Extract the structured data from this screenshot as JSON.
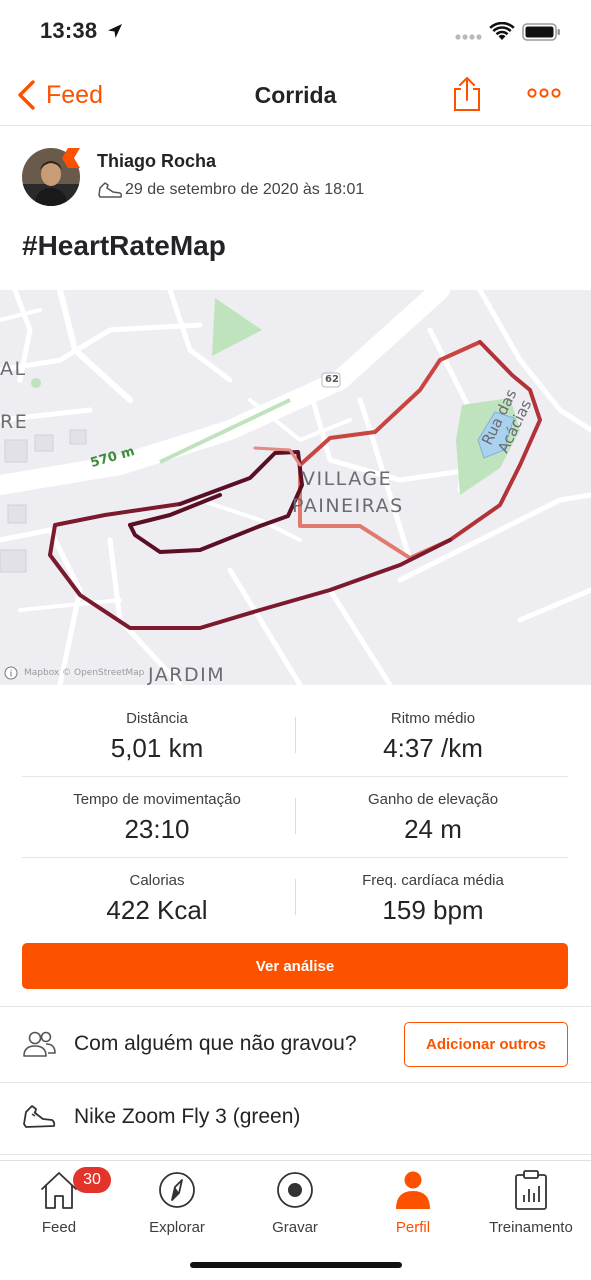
{
  "status_bar": {
    "time": "13:38"
  },
  "nav": {
    "back_label": "Feed",
    "title": "Corrida"
  },
  "athlete": {
    "name": "Thiago Rocha",
    "date": "29 de setembro de 2020 às 18:01"
  },
  "activity": {
    "title": "#HeartRateMap"
  },
  "map": {
    "labels": {
      "elev_marker": "570 m",
      "highway": "62",
      "district_1": "VILLAGE",
      "district_2": "PAINEIRAS",
      "street": "Rua das Acácias",
      "jardim": "JARDIM",
      "left_1": "AL",
      "left_2": "RE",
      "attribution": "Mapbox © OpenStreetMap"
    },
    "colors": {
      "route_high": "#5a0f24",
      "route_mid": "#b2323a",
      "route_low": "#e07a6e",
      "park": "#bfe3bc",
      "water": "#a9d2ee"
    }
  },
  "stats": [
    {
      "left": {
        "label": "Distância",
        "value": "5,01 km"
      },
      "right": {
        "label": "Ritmo médio",
        "value": "4:37 /km"
      }
    },
    {
      "left": {
        "label": "Tempo de movimentação",
        "value": "23:10"
      },
      "right": {
        "label": "Ganho de elevação",
        "value": "24 m"
      }
    },
    {
      "left": {
        "label": "Calorias",
        "value": "422 Kcal"
      },
      "right": {
        "label": "Freq. cardíaca média",
        "value": "159 bpm"
      }
    }
  ],
  "cta": {
    "label": "Ver análise"
  },
  "with_others": {
    "text": "Com alguém que não gravou?",
    "button": "Adicionar outros"
  },
  "gear": {
    "text": "Nike Zoom Fly 3 (green)"
  },
  "tabs": [
    {
      "label": "Feed",
      "icon": "home-icon",
      "badge": "30"
    },
    {
      "label": "Explorar",
      "icon": "compass-icon"
    },
    {
      "label": "Gravar",
      "icon": "record-icon"
    },
    {
      "label": "Perfil",
      "icon": "profile-icon",
      "active": true
    },
    {
      "label": "Treinamento",
      "icon": "training-icon"
    }
  ],
  "colors": {
    "accent": "#fc5200",
    "badge": "#e2342a"
  }
}
